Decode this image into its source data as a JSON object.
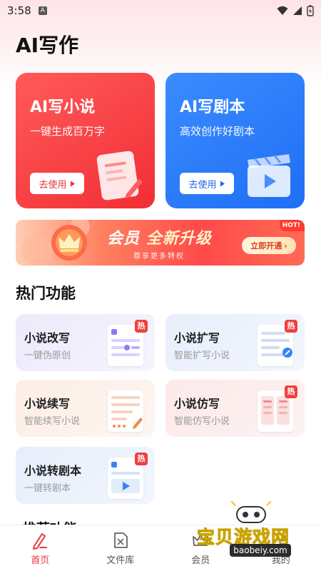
{
  "status_bar": {
    "time": "3:58",
    "notif_icon": "A"
  },
  "page": {
    "title": "AI写作"
  },
  "big_cards": [
    {
      "title": "AI写小说",
      "subtitle": "一键生成百万字",
      "button": "去使用",
      "color": "#f22e35"
    },
    {
      "title": "AI写剧本",
      "subtitle": "高效创作好剧本",
      "button": "去使用",
      "color": "#1f6ef5"
    }
  ],
  "vip_banner": {
    "title_left": "会员",
    "title_right": "全新升级",
    "subtitle": "尊享更多特权",
    "hot": "HOT!",
    "button": "立即开通"
  },
  "hot_section": {
    "title": "热门功能",
    "hot_tag": "热",
    "items": [
      {
        "name": "小说改写",
        "desc": "一键伪原创",
        "hot": true
      },
      {
        "name": "小说扩写",
        "desc": "智能扩写小说",
        "hot": true
      },
      {
        "name": "小说续写",
        "desc": "智能续写小说",
        "hot": false
      },
      {
        "name": "小说仿写",
        "desc": "智能仿写小说",
        "hot": true
      },
      {
        "name": "小说转剧本",
        "desc": "一键转剧本",
        "hot": true
      }
    ]
  },
  "next_section": {
    "title": "推荐功能"
  },
  "tab_bar": {
    "items": [
      {
        "label": "首页",
        "icon": "pen-icon",
        "active": true
      },
      {
        "label": "文件库",
        "icon": "document-icon",
        "active": false
      },
      {
        "label": "会员",
        "icon": "crown-icon",
        "active": false
      },
      {
        "label": "我的",
        "icon": "user-icon",
        "active": false
      }
    ],
    "accent": "#e8373d"
  },
  "watermark": {
    "text": "宝贝游戏网",
    "url": "baobeiy.com"
  }
}
